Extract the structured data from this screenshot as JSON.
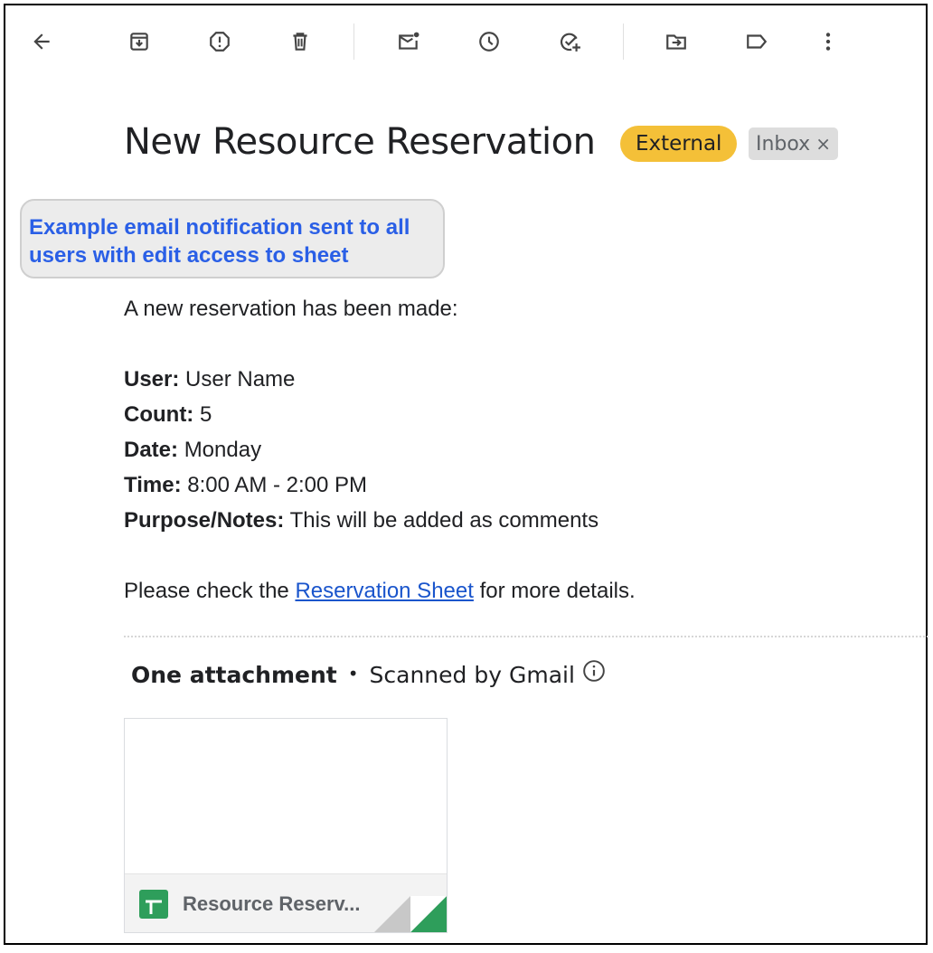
{
  "toolbar": {
    "icons": [
      "back-arrow-icon",
      "archive-icon",
      "report-spam-icon",
      "delete-icon",
      "mark-unread-icon",
      "snooze-icon",
      "add-to-tasks-icon",
      "move-to-icon",
      "labels-icon",
      "more-options-icon"
    ]
  },
  "email": {
    "subject": "New Resource Reservation",
    "tags": {
      "external": "External",
      "inbox": "Inbox",
      "inbox_remove": "×"
    },
    "tag_colors": {
      "external": "#f4c038",
      "inbox": "#dddddd"
    }
  },
  "callout": {
    "text": "Example email notification sent to all users with edit access to sheet",
    "color": "#2a5fe6"
  },
  "body": {
    "intro": "A new reservation has been made:",
    "fields": [
      {
        "label": "User:",
        "value": "User Name"
      },
      {
        "label": "Count:",
        "value": "5"
      },
      {
        "label": "Date:",
        "value": "Monday"
      },
      {
        "label": "Time:",
        "value": "8:00 AM - 2:00 PM"
      },
      {
        "label": "Purpose/Notes:",
        "value": "This will be added as comments"
      }
    ],
    "closing_prefix": "Please check the",
    "closing_link": "Reservation Sheet",
    "closing_suffix": "for more details."
  },
  "attachments": {
    "heading": "One attachment",
    "separator": "•",
    "scanned": "Scanned by Gmail",
    "items": [
      {
        "name": "Resource Reserv...",
        "type_icon": "google-sheets-icon"
      }
    ]
  }
}
